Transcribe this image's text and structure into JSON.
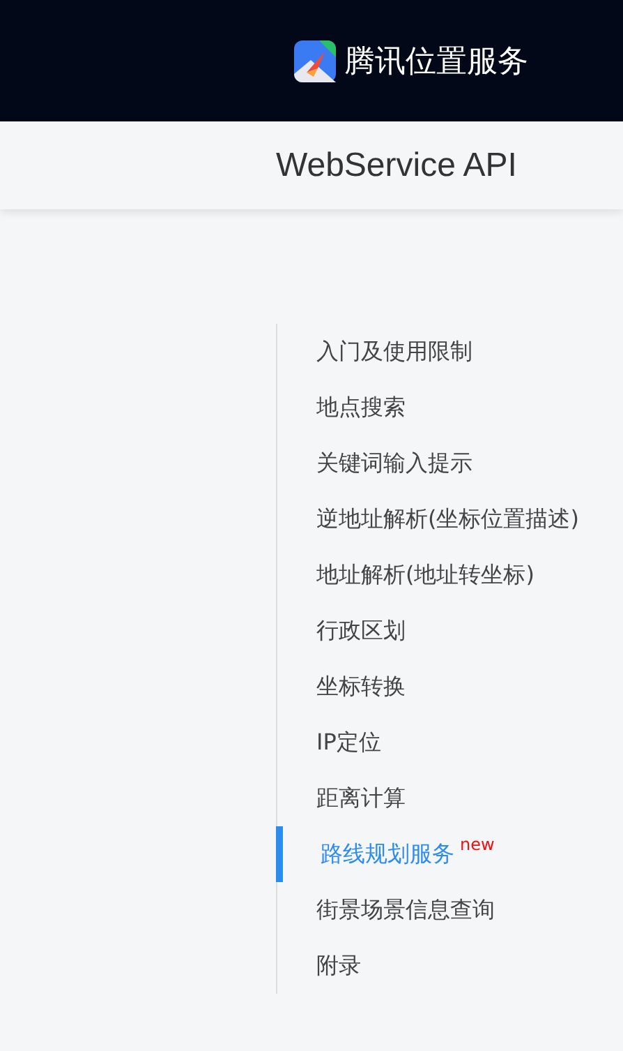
{
  "header": {
    "brand": "腾讯位置服务"
  },
  "subheader": {
    "title": "WebService API"
  },
  "nav": {
    "items": [
      {
        "label": "入门及使用限制",
        "selected": false
      },
      {
        "label": "地点搜索",
        "selected": false
      },
      {
        "label": "关键词输入提示",
        "selected": false
      },
      {
        "label": "逆地址解析(坐标位置描述)",
        "selected": false
      },
      {
        "label": "地址解析(地址转坐标)",
        "selected": false
      },
      {
        "label": "行政区划",
        "selected": false
      },
      {
        "label": "坐标转换",
        "selected": false
      },
      {
        "label": "IP定位",
        "selected": false
      },
      {
        "label": "距离计算",
        "selected": false
      },
      {
        "label": "路线规划服务",
        "selected": true,
        "badge": "new"
      },
      {
        "label": "街景场景信息查询",
        "selected": false
      },
      {
        "label": "附录",
        "selected": false
      }
    ]
  }
}
